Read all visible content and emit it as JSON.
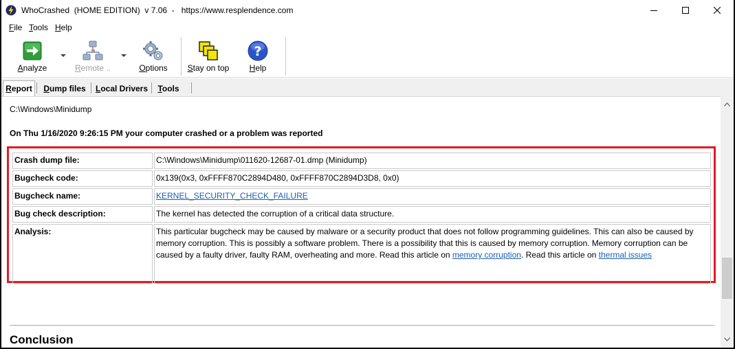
{
  "window": {
    "title": "WhoCrashed  (HOME EDITION)  v 7.06  -   https://www.resplendence.com"
  },
  "menu": {
    "file": {
      "u": "F",
      "rest": "ile"
    },
    "tools": {
      "u": "T",
      "rest": "ools"
    },
    "help": {
      "u": "H",
      "rest": "elp"
    }
  },
  "toolbar": {
    "analyze": {
      "u": "A",
      "rest": "nalyze"
    },
    "remote": {
      "u": "R",
      "rest": "emote .."
    },
    "options": {
      "u": "O",
      "rest": "ptions"
    },
    "stay_on_top": {
      "u": "S",
      "rest": "tay on top"
    },
    "help": {
      "u": "H",
      "rest": "elp"
    }
  },
  "tabs": [
    {
      "u": "R",
      "rest": "eport",
      "active": true
    },
    {
      "u": "D",
      "rest": "ump files"
    },
    {
      "u": "L",
      "rest": "ocal Drivers"
    },
    {
      "u": "T",
      "rest": "ools"
    }
  ],
  "report": {
    "path": "C:\\Windows\\Minidump",
    "crash_heading": "On Thu 1/16/2020 9:26:15 PM your computer crashed or a problem was reported",
    "rows": {
      "dump_file": {
        "label": "Crash dump file:",
        "value": "C:\\Windows\\Minidump\\011620-12687-01.dmp (Minidump)"
      },
      "bugcheck_code": {
        "label": "Bugcheck code:",
        "value": "0x139(0x3, 0xFFFF870C2894D480, 0xFFFF870C2894D3D8, 0x0)"
      },
      "bugcheck_name": {
        "label": "Bugcheck name:",
        "value": "KERNEL_SECURITY_CHECK_FAILURE"
      },
      "description": {
        "label": "Bug check description:",
        "value": "The kernel has detected the corruption of a critical data structure."
      },
      "analysis": {
        "label": "Analysis:",
        "text_1": "This particular bugcheck may be caused by malware or a security product that does not follow programming guidelines. This can also be caused by memory corruption. This is possibly a software problem. There is a possibility that this is caused by memory corruption. Memory corruption can be caused by a faulty driver, faulty RAM, overheating and more. Read this article on ",
        "link_1": "memory corruption",
        "text_2": ". Read this article on ",
        "link_2": "thermal issues"
      }
    },
    "conclusion": "Conclusion"
  },
  "colors": {
    "highlight_border": "#e31b23",
    "link": "#1a5fb4"
  }
}
